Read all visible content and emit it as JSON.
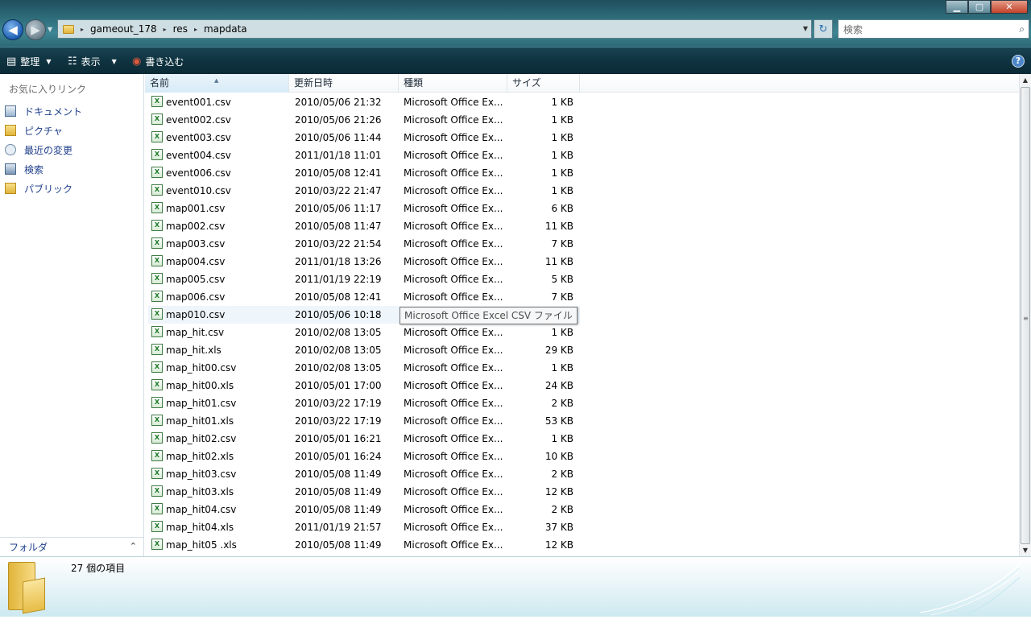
{
  "window": {
    "minimize": "▁",
    "maximize": "▢",
    "close": "✕"
  },
  "nav": {
    "back": "◀",
    "forward": "▶",
    "dropdown": "▼"
  },
  "address": {
    "crumbs": [
      "gameout_178",
      "res",
      "mapdata"
    ],
    "separator": "▸"
  },
  "search": {
    "placeholder": "検索"
  },
  "toolbar": {
    "organize": "整理",
    "view": "表示",
    "burn": "書き込む",
    "help": "?"
  },
  "sidebar": {
    "favorites_header": "お気に入りリンク",
    "items": [
      {
        "label": "ドキュメント",
        "icon": "documents-icon"
      },
      {
        "label": "ピクチャ",
        "icon": "pictures-icon"
      },
      {
        "label": "最近の変更",
        "icon": "recent-changes-icon"
      },
      {
        "label": "検索",
        "icon": "searches-icon"
      },
      {
        "label": "パブリック",
        "icon": "public-icon"
      }
    ],
    "folders_label": "フォルダ"
  },
  "columns": {
    "name": "名前",
    "date": "更新日時",
    "type": "種類",
    "size": "サイズ"
  },
  "files": [
    {
      "name": "event001.csv",
      "date": "2010/05/06 21:32",
      "type": "Microsoft Office Ex...",
      "size": "1 KB"
    },
    {
      "name": "event002.csv",
      "date": "2010/05/06 21:26",
      "type": "Microsoft Office Ex...",
      "size": "1 KB"
    },
    {
      "name": "event003.csv",
      "date": "2010/05/06 11:44",
      "type": "Microsoft Office Ex...",
      "size": "1 KB"
    },
    {
      "name": "event004.csv",
      "date": "2011/01/18 11:01",
      "type": "Microsoft Office Ex...",
      "size": "1 KB"
    },
    {
      "name": "event006.csv",
      "date": "2010/05/08 12:41",
      "type": "Microsoft Office Ex...",
      "size": "1 KB"
    },
    {
      "name": "event010.csv",
      "date": "2010/03/22 21:47",
      "type": "Microsoft Office Ex...",
      "size": "1 KB"
    },
    {
      "name": "map001.csv",
      "date": "2010/05/06 11:17",
      "type": "Microsoft Office Ex...",
      "size": "6 KB"
    },
    {
      "name": "map002.csv",
      "date": "2010/05/08 11:47",
      "type": "Microsoft Office Ex...",
      "size": "11 KB"
    },
    {
      "name": "map003.csv",
      "date": "2010/03/22 21:54",
      "type": "Microsoft Office Ex...",
      "size": "7 KB"
    },
    {
      "name": "map004.csv",
      "date": "2011/01/18 13:26",
      "type": "Microsoft Office Ex...",
      "size": "11 KB"
    },
    {
      "name": "map005.csv",
      "date": "2011/01/19 22:19",
      "type": "Microsoft Office Ex...",
      "size": "5 KB"
    },
    {
      "name": "map006.csv",
      "date": "2010/05/08 12:41",
      "type": "Microsoft Office Ex...",
      "size": "7 KB"
    },
    {
      "name": "map010.csv",
      "date": "2010/05/06 10:18",
      "type": "",
      "size": ""
    },
    {
      "name": "map_hit.csv",
      "date": "2010/02/08 13:05",
      "type": "Microsoft Office Ex...",
      "size": "1 KB"
    },
    {
      "name": "map_hit.xls",
      "date": "2010/02/08 13:05",
      "type": "Microsoft Office Ex...",
      "size": "29 KB"
    },
    {
      "name": "map_hit00.csv",
      "date": "2010/02/08 13:05",
      "type": "Microsoft Office Ex...",
      "size": "1 KB"
    },
    {
      "name": "map_hit00.xls",
      "date": "2010/05/01 17:00",
      "type": "Microsoft Office Ex...",
      "size": "24 KB"
    },
    {
      "name": "map_hit01.csv",
      "date": "2010/03/22 17:19",
      "type": "Microsoft Office Ex...",
      "size": "2 KB"
    },
    {
      "name": "map_hit01.xls",
      "date": "2010/03/22 17:19",
      "type": "Microsoft Office Ex...",
      "size": "53 KB"
    },
    {
      "name": "map_hit02.csv",
      "date": "2010/05/01 16:21",
      "type": "Microsoft Office Ex...",
      "size": "1 KB"
    },
    {
      "name": "map_hit02.xls",
      "date": "2010/05/01 16:24",
      "type": "Microsoft Office Ex...",
      "size": "10 KB"
    },
    {
      "name": "map_hit03.csv",
      "date": "2010/05/08 11:49",
      "type": "Microsoft Office Ex...",
      "size": "2 KB"
    },
    {
      "name": "map_hit03.xls",
      "date": "2010/05/08 11:49",
      "type": "Microsoft Office Ex...",
      "size": "12 KB"
    },
    {
      "name": "map_hit04.csv",
      "date": "2010/05/08 11:49",
      "type": "Microsoft Office Ex...",
      "size": "2 KB"
    },
    {
      "name": "map_hit04.xls",
      "date": "2011/01/19 21:57",
      "type": "Microsoft Office Ex...",
      "size": "37 KB"
    },
    {
      "name": "map_hit05 .xls",
      "date": "2010/05/08 11:49",
      "type": "Microsoft Office Ex...",
      "size": "12 KB"
    }
  ],
  "hover_row": 12,
  "tooltip": "Microsoft Office Excel CSV ファイル",
  "status": {
    "item_count": "27 個の項目"
  },
  "colors": {
    "accent": "#1e3f8a",
    "chrome": "#2f6e7c",
    "hover": "#eef5fb"
  }
}
